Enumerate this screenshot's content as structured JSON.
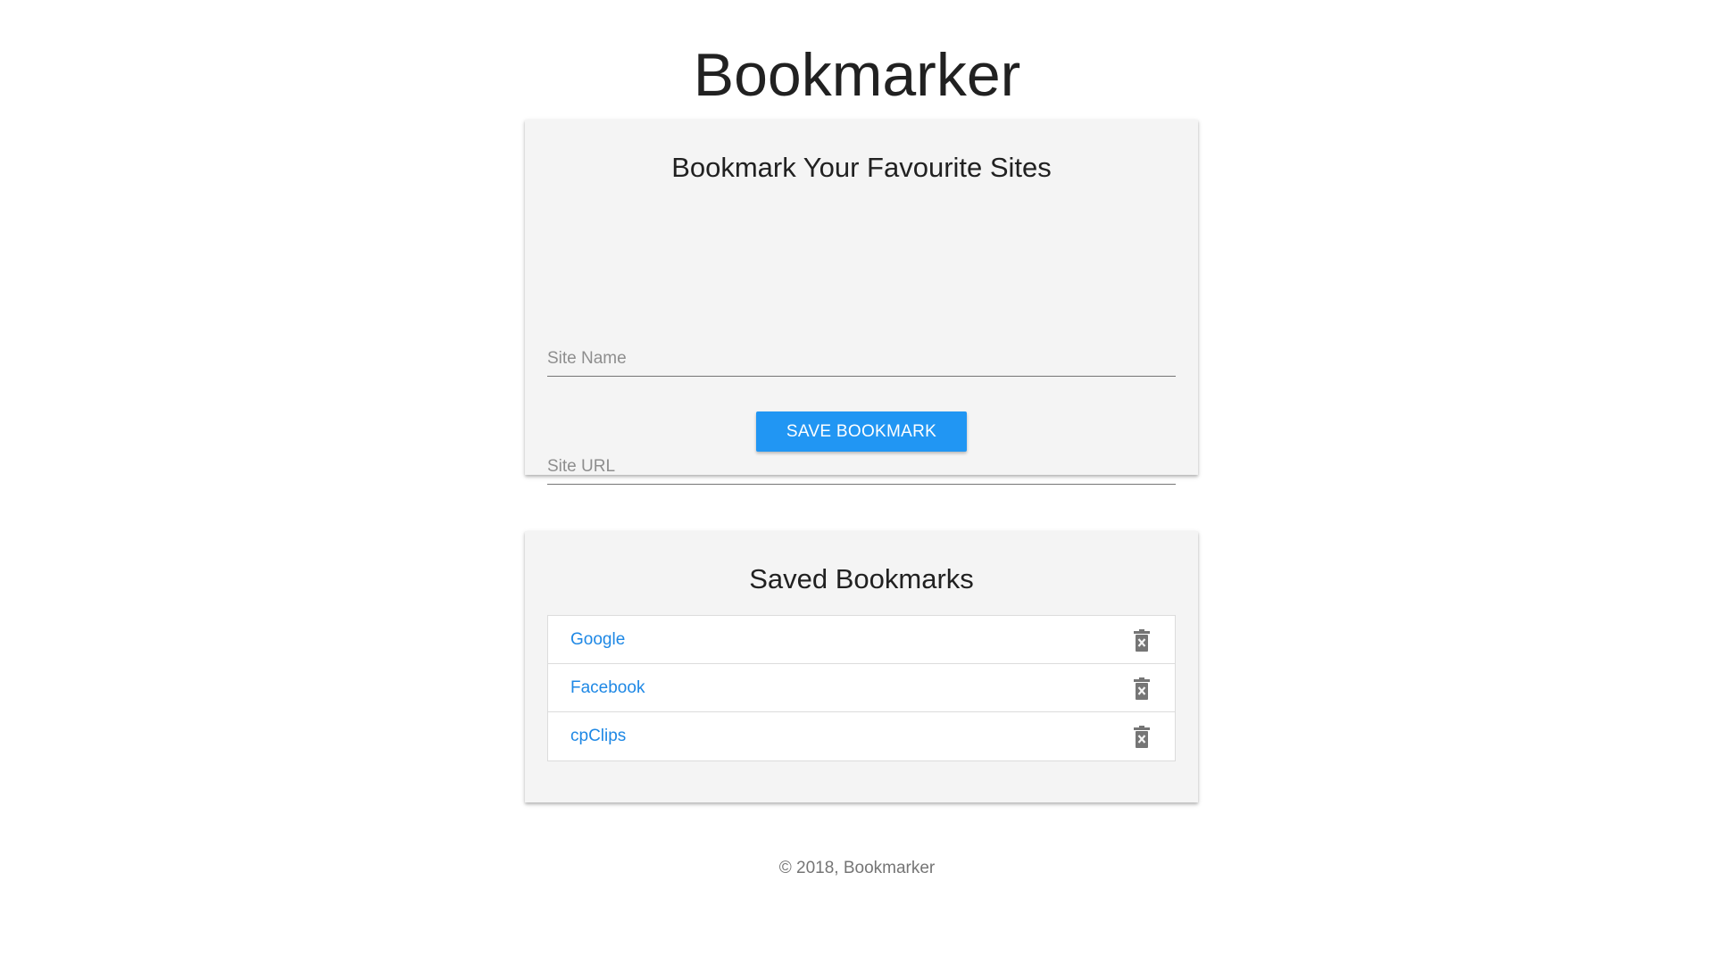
{
  "header": {
    "title": "Bookmarker"
  },
  "form_card": {
    "title": "Bookmark Your Favourite Sites",
    "site_name": {
      "placeholder": "Site Name",
      "value": ""
    },
    "site_url": {
      "placeholder": "Site URL",
      "value": ""
    },
    "save_label": "Save Bookmark"
  },
  "list_card": {
    "title": "Saved Bookmarks",
    "items": [
      {
        "name": "Google",
        "icon": "delete-icon"
      },
      {
        "name": "Facebook",
        "icon": "delete-icon"
      },
      {
        "name": "cpClips",
        "icon": "delete-icon"
      }
    ]
  },
  "footer": {
    "text": "© 2018, Bookmarker"
  },
  "colors": {
    "primary": "#2196f3",
    "link": "#1e88e5",
    "card_bg": "#f4f4f4",
    "icon": "#757575"
  }
}
